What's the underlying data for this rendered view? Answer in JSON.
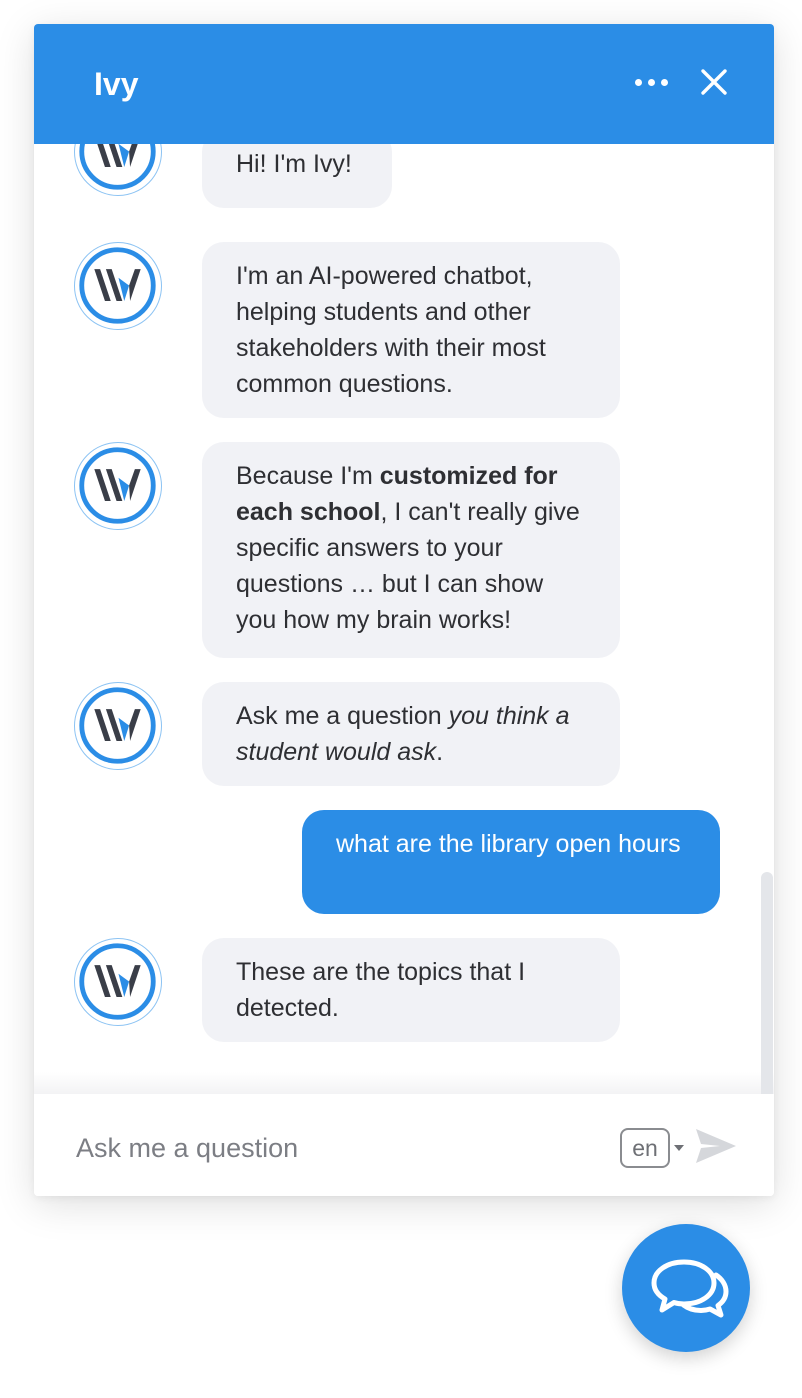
{
  "header": {
    "title": "Ivy",
    "more_icon": "more-horizontal-icon",
    "close_icon": "close-icon",
    "color": "#2b8de6"
  },
  "avatar": {
    "icon": "ivy-logo-icon"
  },
  "messages": [
    {
      "from": "bot",
      "segments": [
        {
          "text": "Hi! I'm Ivy!",
          "style": "normal"
        }
      ]
    },
    {
      "from": "bot",
      "segments": [
        {
          "text": "I'm an AI-powered chatbot, helping students and other stakeholders with their most common questions.",
          "style": "normal"
        }
      ]
    },
    {
      "from": "bot",
      "segments": [
        {
          "text": "Because I'm ",
          "style": "normal"
        },
        {
          "text": "customized for each school",
          "style": "bold"
        },
        {
          "text": ", I can't really give specific answers to your questions … but I can show you how my brain works!",
          "style": "normal"
        }
      ]
    },
    {
      "from": "bot",
      "segments": [
        {
          "text": "Ask me a question ",
          "style": "normal"
        },
        {
          "text": "you think a student would ask",
          "style": "italic"
        },
        {
          "text": ".",
          "style": "normal"
        }
      ]
    },
    {
      "from": "user",
      "segments": [
        {
          "text": "what are the library open hours",
          "style": "normal"
        }
      ]
    },
    {
      "from": "bot",
      "segments": [
        {
          "text": "These are the topics that I detected.",
          "style": "normal"
        }
      ]
    }
  ],
  "composer": {
    "placeholder": "Ask me a question",
    "value": "",
    "language": "en",
    "send_icon": "send-icon"
  },
  "launcher": {
    "icon": "chat-bubbles-icon",
    "color": "#2b8de6"
  },
  "colors": {
    "accent": "#2b8de6",
    "bot_bubble": "#f1f2f6",
    "text": "#2e2f33"
  }
}
